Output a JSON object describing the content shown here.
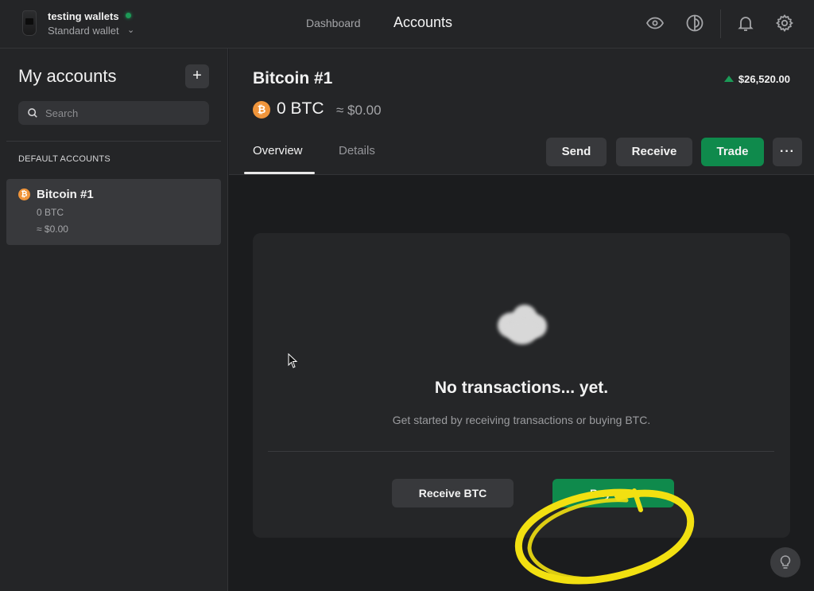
{
  "topbar": {
    "wallet_name": "testing wallets",
    "wallet_type": "Standard wallet",
    "connection_status": "connected",
    "status_color": "#1d9a57",
    "nav": [
      {
        "label": "Dashboard",
        "active": false
      },
      {
        "label": "Accounts",
        "active": true
      }
    ],
    "icons": [
      "eye-icon",
      "theme-contrast-icon",
      "bell-icon",
      "gear-icon"
    ]
  },
  "sidebar": {
    "title": "My accounts",
    "add_label": "+",
    "search_placeholder": "Search",
    "section_label": "DEFAULT ACCOUNTS",
    "accounts": [
      {
        "name": "Bitcoin #1",
        "balance": "0 BTC",
        "fiat": "≈ $0.00",
        "coin_symbol": "₿",
        "selected": true
      }
    ]
  },
  "header": {
    "title": "Bitcoin #1",
    "coin_symbol": "₿",
    "balance": "0 BTC",
    "fiat": "≈ $0.00",
    "price": "$26,520.00",
    "price_trend": "up",
    "tabs": [
      {
        "label": "Overview",
        "active": true
      },
      {
        "label": "Details",
        "active": false
      }
    ],
    "actions": {
      "send": "Send",
      "receive": "Receive",
      "trade": "Trade",
      "more": "···"
    }
  },
  "empty_state": {
    "title": "No transactions... yet.",
    "subtitle": "Get started by receiving transactions or buying BTC.",
    "receive_btn": "Receive BTC",
    "buy_btn": "Buy BTC",
    "annotation": "yellow circle highlighting Buy BTC"
  },
  "colors": {
    "accent_green": "#0f8a4c",
    "bitcoin_orange": "#f0953b",
    "highlight_yellow": "#f5e000",
    "background": "#1b1c1e",
    "panel": "#242527"
  }
}
